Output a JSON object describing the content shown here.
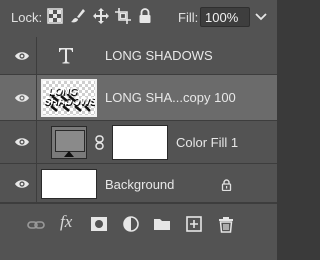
{
  "lockbar": {
    "lock_label": "Lock:",
    "fill_label": "Fill:",
    "fill_value": "100%",
    "lock_icons": [
      "lock-transparent-pixels-icon",
      "lock-image-pixels-icon",
      "lock-position-icon",
      "lock-artboard-icon",
      "lock-all-icon"
    ]
  },
  "layers": [
    {
      "name": "LONG SHADOWS",
      "kind": "type",
      "visible": true,
      "selected": false
    },
    {
      "name": "LONG SHA...copy 100",
      "kind": "pixel",
      "visible": true,
      "selected": true,
      "thumb_text": "LONG SHADOWS"
    },
    {
      "name": "Color Fill 1",
      "kind": "fill",
      "visible": true,
      "selected": false
    },
    {
      "name": "Background",
      "kind": "background",
      "visible": true,
      "selected": false,
      "locked": true
    }
  ],
  "toolbar": {
    "fx_label": "fx",
    "icons": [
      "link-layers-icon",
      "fx-icon",
      "add-mask-icon",
      "adjustment-layer-icon",
      "group-folder-icon",
      "new-layer-icon",
      "delete-icon"
    ]
  },
  "colors": {
    "panel": "#535353",
    "selected_row": "#6b6b6b",
    "divider": "#3d3d3d",
    "text": "#e8e8e8"
  }
}
